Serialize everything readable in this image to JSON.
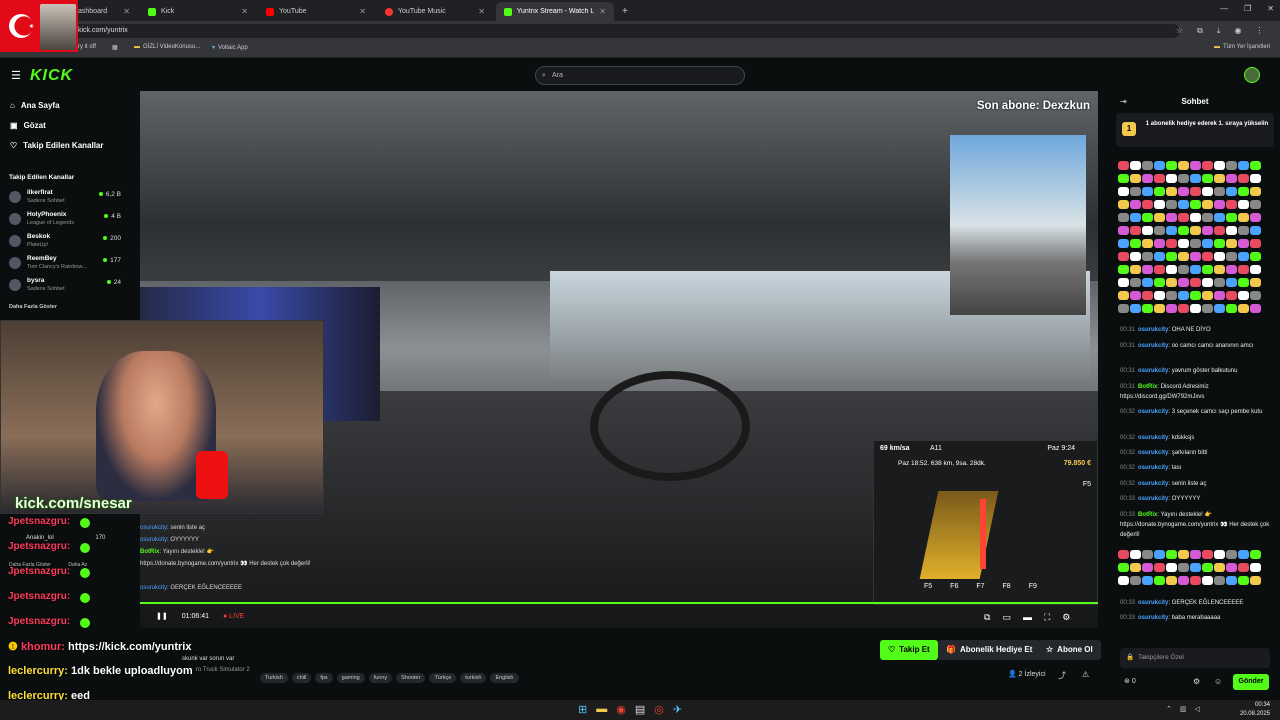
{
  "browser": {
    "tabs": [
      {
        "label": "ashboard"
      },
      {
        "label": "Kick"
      },
      {
        "label": "YouTube"
      },
      {
        "label": "YouTube Music"
      },
      {
        "label": "Yuntrix Stream - Watch Liv"
      }
    ],
    "url": "kick.com/yuntrix",
    "bookmarks": [
      "GİZLİ VideoKonusu...",
      "Voltaic App"
    ],
    "bookmarks_right": "Tüm Yer İşaretleri",
    "bookmark_left_fragment": "rry it off"
  },
  "kick": {
    "logo": "KICK",
    "search_placeholder": "Ara",
    "nav": [
      "Ana Sayfa",
      "Gözat",
      "Takip Edilen Kanallar"
    ],
    "followed_heading": "Takip Edilen Kanallar",
    "channels": [
      {
        "name": "ilkerfirat",
        "sub": "Sadece Sohbet",
        "viewers": "6,2 B"
      },
      {
        "name": "HolyPhoenix",
        "sub": "League of Legends",
        "viewers": "4 B"
      },
      {
        "name": "Beskok",
        "sub": "PlateUp!",
        "viewers": "200"
      },
      {
        "name": "ReemBey",
        "sub": "Tom Clancy's Rainbow...",
        "viewers": "177"
      },
      {
        "name": "bysra",
        "sub": "Sadece Sohbet",
        "viewers": "24"
      }
    ],
    "show_more": "Daha Fazla Göster"
  },
  "video": {
    "last_sub": "Son abone: Dexzkun",
    "cam_watermark": "kick.com/snesar",
    "hud_speed": "69 km/sa",
    "hud_route": "A11",
    "hud_time": "Paz 9:24",
    "hud_info": "Paz 18:52. 638 km, 9sa. 28dk.",
    "hud_money": "79.850 €",
    "fkeys": [
      "F5",
      "F6",
      "F7",
      "F8",
      "F9"
    ],
    "hud_f5": "F5",
    "time_display": "01:06:41",
    "live_label": "LIVE",
    "inner_chat": [
      {
        "user": "osurukcity",
        "text": "senin liste aç"
      },
      {
        "user": "osurukcity",
        "text": "OYYYYYY"
      },
      {
        "user": "BotRix",
        "text": "Yayını destekle! 👉"
      },
      {
        "user": "",
        "text": "https://donate.bynogame.com/yuntrix 👀 Her destek çok değerli!"
      },
      {
        "user": "osurukcity",
        "text": "GERÇEK EĞLENCEEEEE"
      }
    ],
    "inner_side": [
      {
        "name": "Anakin_lol",
        "v": "170"
      },
      {
        "name": "Daha Fazla Göster",
        "v": "Daha Az"
      }
    ],
    "overlay_chat": [
      {
        "user": "Jpetsnazgru:",
        "color": "#ff3b5c"
      },
      {
        "user": "Jpetsnazgru:",
        "color": "#ff3b5c"
      },
      {
        "user": "Jpetsnazgru:",
        "color": "#ff3b5c"
      },
      {
        "user": "Jpetsnazgru:",
        "color": "#ff3b5c"
      },
      {
        "user": "Jpetsnazgru:",
        "color": "#ff3b5c"
      }
    ],
    "overlay_bottom": [
      {
        "user": "khomur:",
        "text": "https://kick.com/yuntrix",
        "color": "#ff3b5c"
      },
      {
        "user": "leclercurry:",
        "text": "1dk bekle uploadluyom",
        "color": "#ffdf3b"
      },
      {
        "user": "leclercurry:",
        "text": "eed",
        "color": "#ffdf3b"
      }
    ],
    "overlay_small": "skunk var sorun var",
    "game_fragment": "ro Truck Simulator 2"
  },
  "below": {
    "tags": [
      "Turkish",
      "chill",
      "fps",
      "gaming",
      "funny",
      "Shooter",
      "Türkçe",
      "turkish",
      "English"
    ],
    "follow_btn": "Takip Et",
    "gift_btn": "Abonelik Hediye Et",
    "sub_btn": "Abone Ol",
    "viewers": "2 İzleyici"
  },
  "chat": {
    "title": "Sohbet",
    "pinned": "1 abonelik hediye ederek 1. sıraya yükselin",
    "pinned_rank": "1",
    "messages": [
      {
        "t": "00:31",
        "u": "osurukcity",
        "x": "OHA NE DİYO"
      },
      {
        "t": "00:31",
        "u": "osurukcity",
        "x": "oo camcı camcı ananının amcı"
      },
      {
        "t": "00:31",
        "u": "osurukcity",
        "x": "yavrum göster balkutunu"
      },
      {
        "t": "00:31",
        "u": "BotRix",
        "x": "Discord Adresimiz https://discord.gg/DW792mJxvs"
      },
      {
        "t": "00:32",
        "u": "osurukcity",
        "x": "3 seçenek camcı saçı pembe kutu"
      },
      {
        "t": "00:32",
        "u": "osurukcity",
        "x": "kdskksjs"
      },
      {
        "t": "00:32",
        "u": "osurukcity",
        "x": "şarkıların bitti"
      },
      {
        "t": "00:32",
        "u": "osurukcity",
        "x": "tası"
      },
      {
        "t": "00:32",
        "u": "osurukcity",
        "x": "senin liste aç"
      },
      {
        "t": "00:33",
        "u": "osurukcity",
        "x": "OYYYYYY"
      },
      {
        "t": "00:33",
        "u": "BotRix",
        "x": "Yayını destekle! 👉 https://donate.bynogame.com/yuntrix 👀 Her destek çok değerli!"
      }
    ],
    "late_messages": [
      {
        "t": "00:33",
        "u": "osurukcity",
        "x": "GERÇEK EĞLENCEEEEE"
      },
      {
        "t": "00:33",
        "u": "osurukcity",
        "x": "baba merabaaaaa"
      }
    ],
    "input_placeholder": "Takipçilere Özel",
    "send": "Gönder",
    "points": "0"
  },
  "taskbar": {
    "time": "00:34",
    "date": "20.08.2025"
  }
}
